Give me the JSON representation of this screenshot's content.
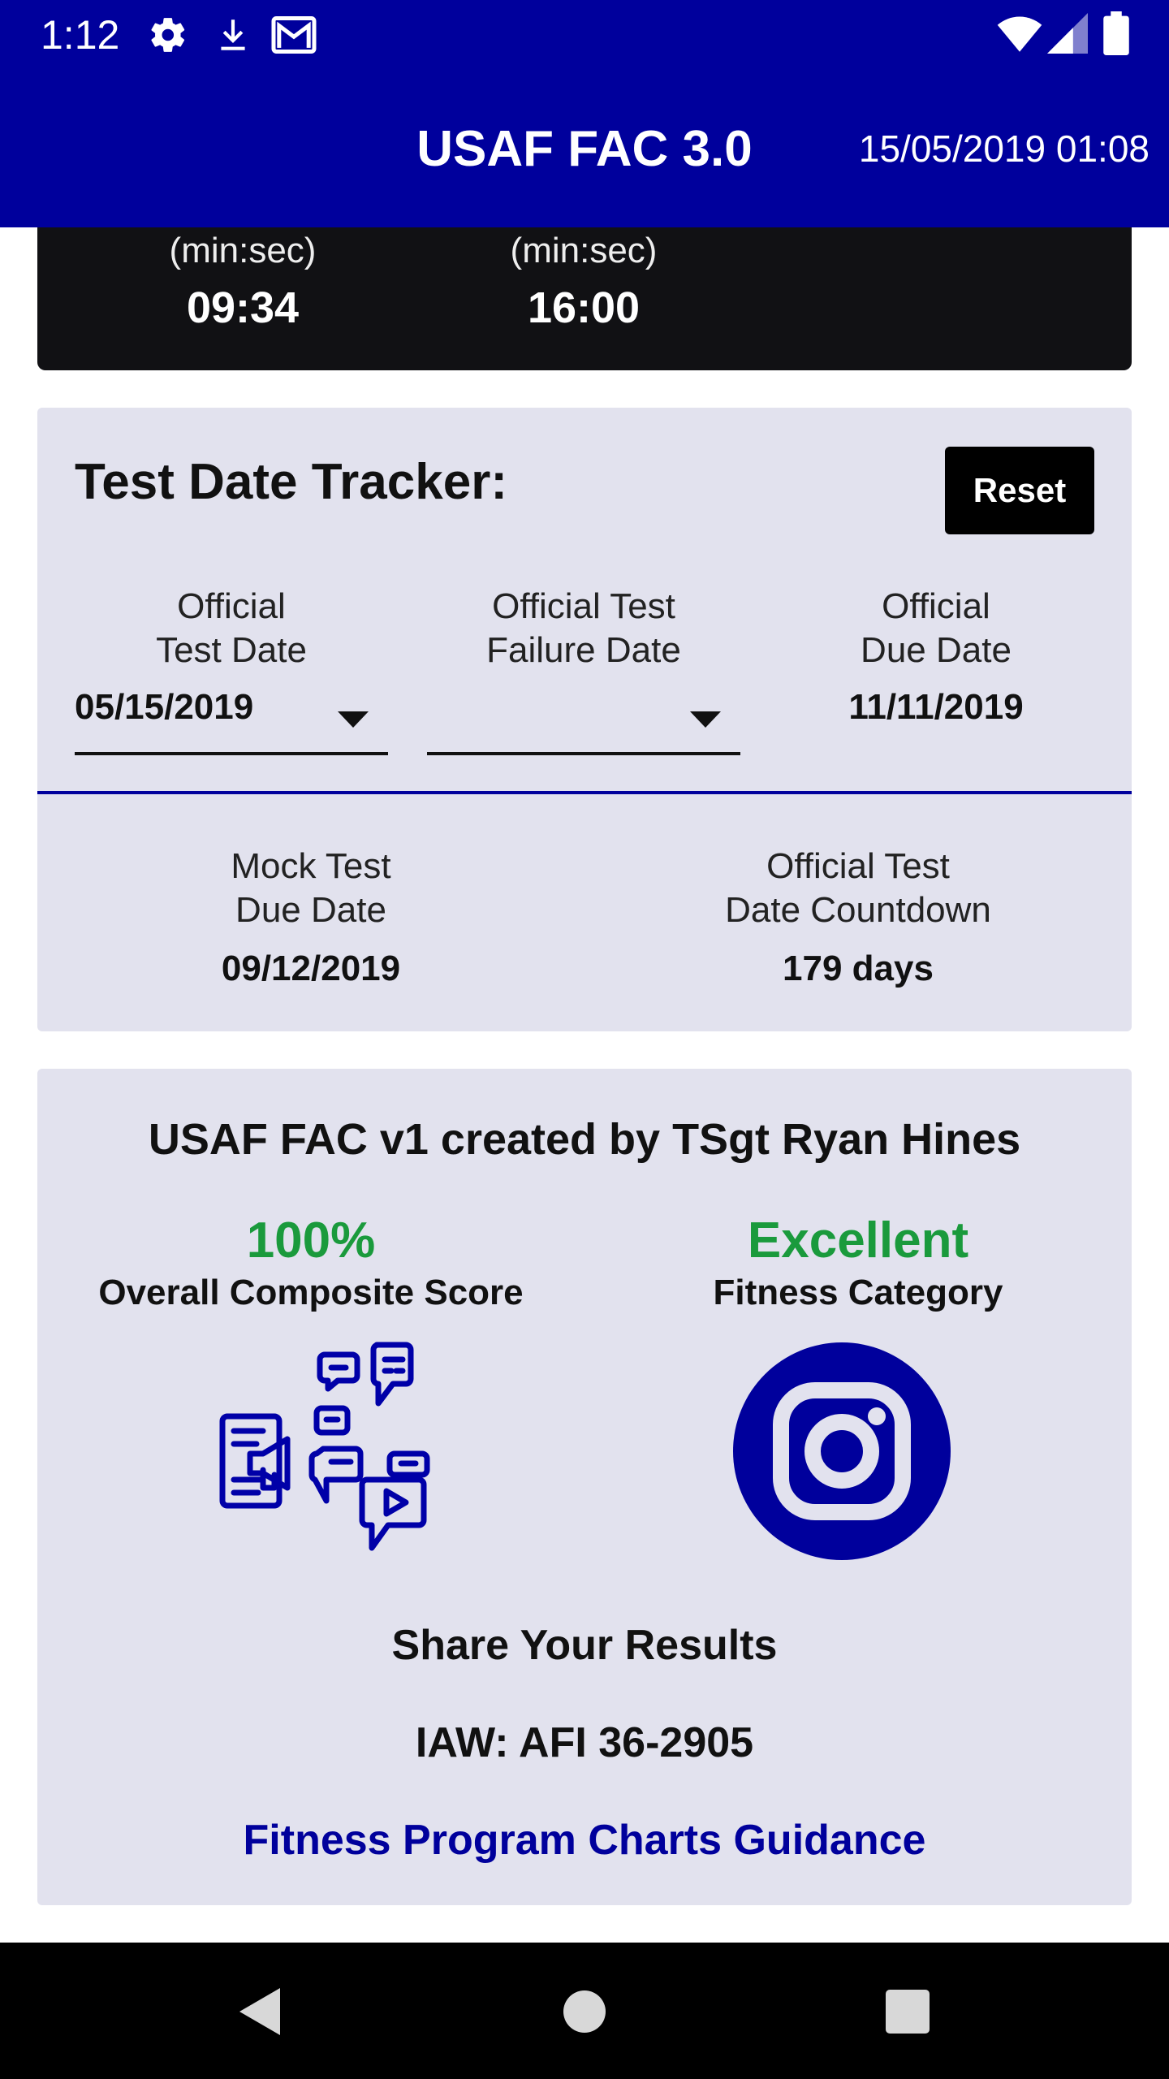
{
  "status_bar": {
    "time": "1:12",
    "icons": [
      "gear-icon",
      "download-icon",
      "gmail-icon",
      "wifi-icon",
      "signal-icon",
      "battery-icon"
    ]
  },
  "app_bar": {
    "title": "USAF FAC 3.0",
    "datetime": "15/05/2019 01:08",
    "background_color": "#00009c"
  },
  "timer_card": {
    "columns": [
      {
        "unit": "(min:sec)",
        "value": "09:34"
      },
      {
        "unit": "(min:sec)",
        "value": "16:00"
      }
    ]
  },
  "tracker": {
    "title": "Test Date Tracker:",
    "reset_label": "Reset",
    "official_test_date": {
      "label_line1": "Official",
      "label_line2": "Test Date",
      "value": "05/15/2019"
    },
    "official_failure_date": {
      "label_line1": "Official Test",
      "label_line2": "Failure Date",
      "value": ""
    },
    "official_due_date": {
      "label_line1": "Official",
      "label_line2": "Due Date",
      "value": "11/11/2019"
    },
    "mock_due_date": {
      "label_line1": "Mock Test",
      "label_line2": "Due Date",
      "value": "09/12/2019"
    },
    "countdown": {
      "label_line1": "Official Test",
      "label_line2": "Date Countdown",
      "value": "179 days"
    }
  },
  "share": {
    "creator": "USAF FAC v1 created by TSgt Ryan Hines",
    "score": {
      "value": "100%",
      "label": "Overall Composite Score"
    },
    "category": {
      "value": "Excellent",
      "label": "Fitness Category"
    },
    "score_color": "#1a9a3c",
    "icons": [
      "social-media-chat-icon",
      "instagram-icon"
    ],
    "share_title": "Share Your Results",
    "iaw": "IAW: AFI 36-2905",
    "guidance_link": "Fitness Program Charts Guidance"
  },
  "nav_bar": {
    "icons": [
      "back-icon",
      "home-icon",
      "recents-icon"
    ]
  }
}
